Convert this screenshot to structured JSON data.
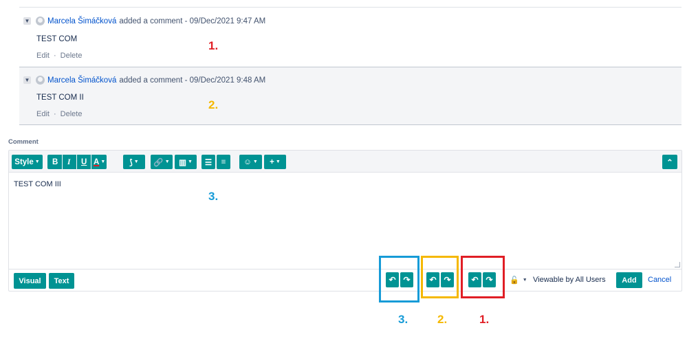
{
  "comments": [
    {
      "author": "Marcela Šimáčková",
      "action": "added a comment - 09/Dec/2021 9:47 AM",
      "body": "TEST COM",
      "edit": "Edit",
      "sep": "·",
      "delete": "Delete",
      "marker": "1."
    },
    {
      "author": "Marcela Šimáčková",
      "action": "added a comment - 09/Dec/2021 9:48 AM",
      "body": "TEST COM II",
      "edit": "Edit",
      "sep": "·",
      "delete": "Delete",
      "marker": "2."
    }
  ],
  "editor": {
    "label": "Comment",
    "toolbar": {
      "style": "Style",
      "bold": "B",
      "italic": "I",
      "underline": "U",
      "text_color": "A",
      "icons": [
        "chevron-down-icon",
        "bold-icon",
        "italic-icon",
        "underline-icon",
        "text-color-icon",
        "format-icon",
        "link-icon",
        "attachment-icon",
        "bullet-list-icon",
        "numbered-list-icon",
        "emoji-icon",
        "plus-icon",
        "collapse-toolbar-icon"
      ]
    },
    "content": "TEST COM III",
    "content_marker": "3.",
    "modes": {
      "visual": "Visual",
      "text": "Text"
    }
  },
  "footer": {
    "viewable": "Viewable by All Users",
    "add": "Add",
    "cancel": "Cancel"
  },
  "annotations": {
    "blue": "3.",
    "yellow": "2.",
    "red": "1."
  },
  "colors": {
    "teal": "#009393",
    "red": "#e01e25",
    "yellow": "#f5b800",
    "blue": "#169bd7",
    "link": "#0052cc"
  }
}
